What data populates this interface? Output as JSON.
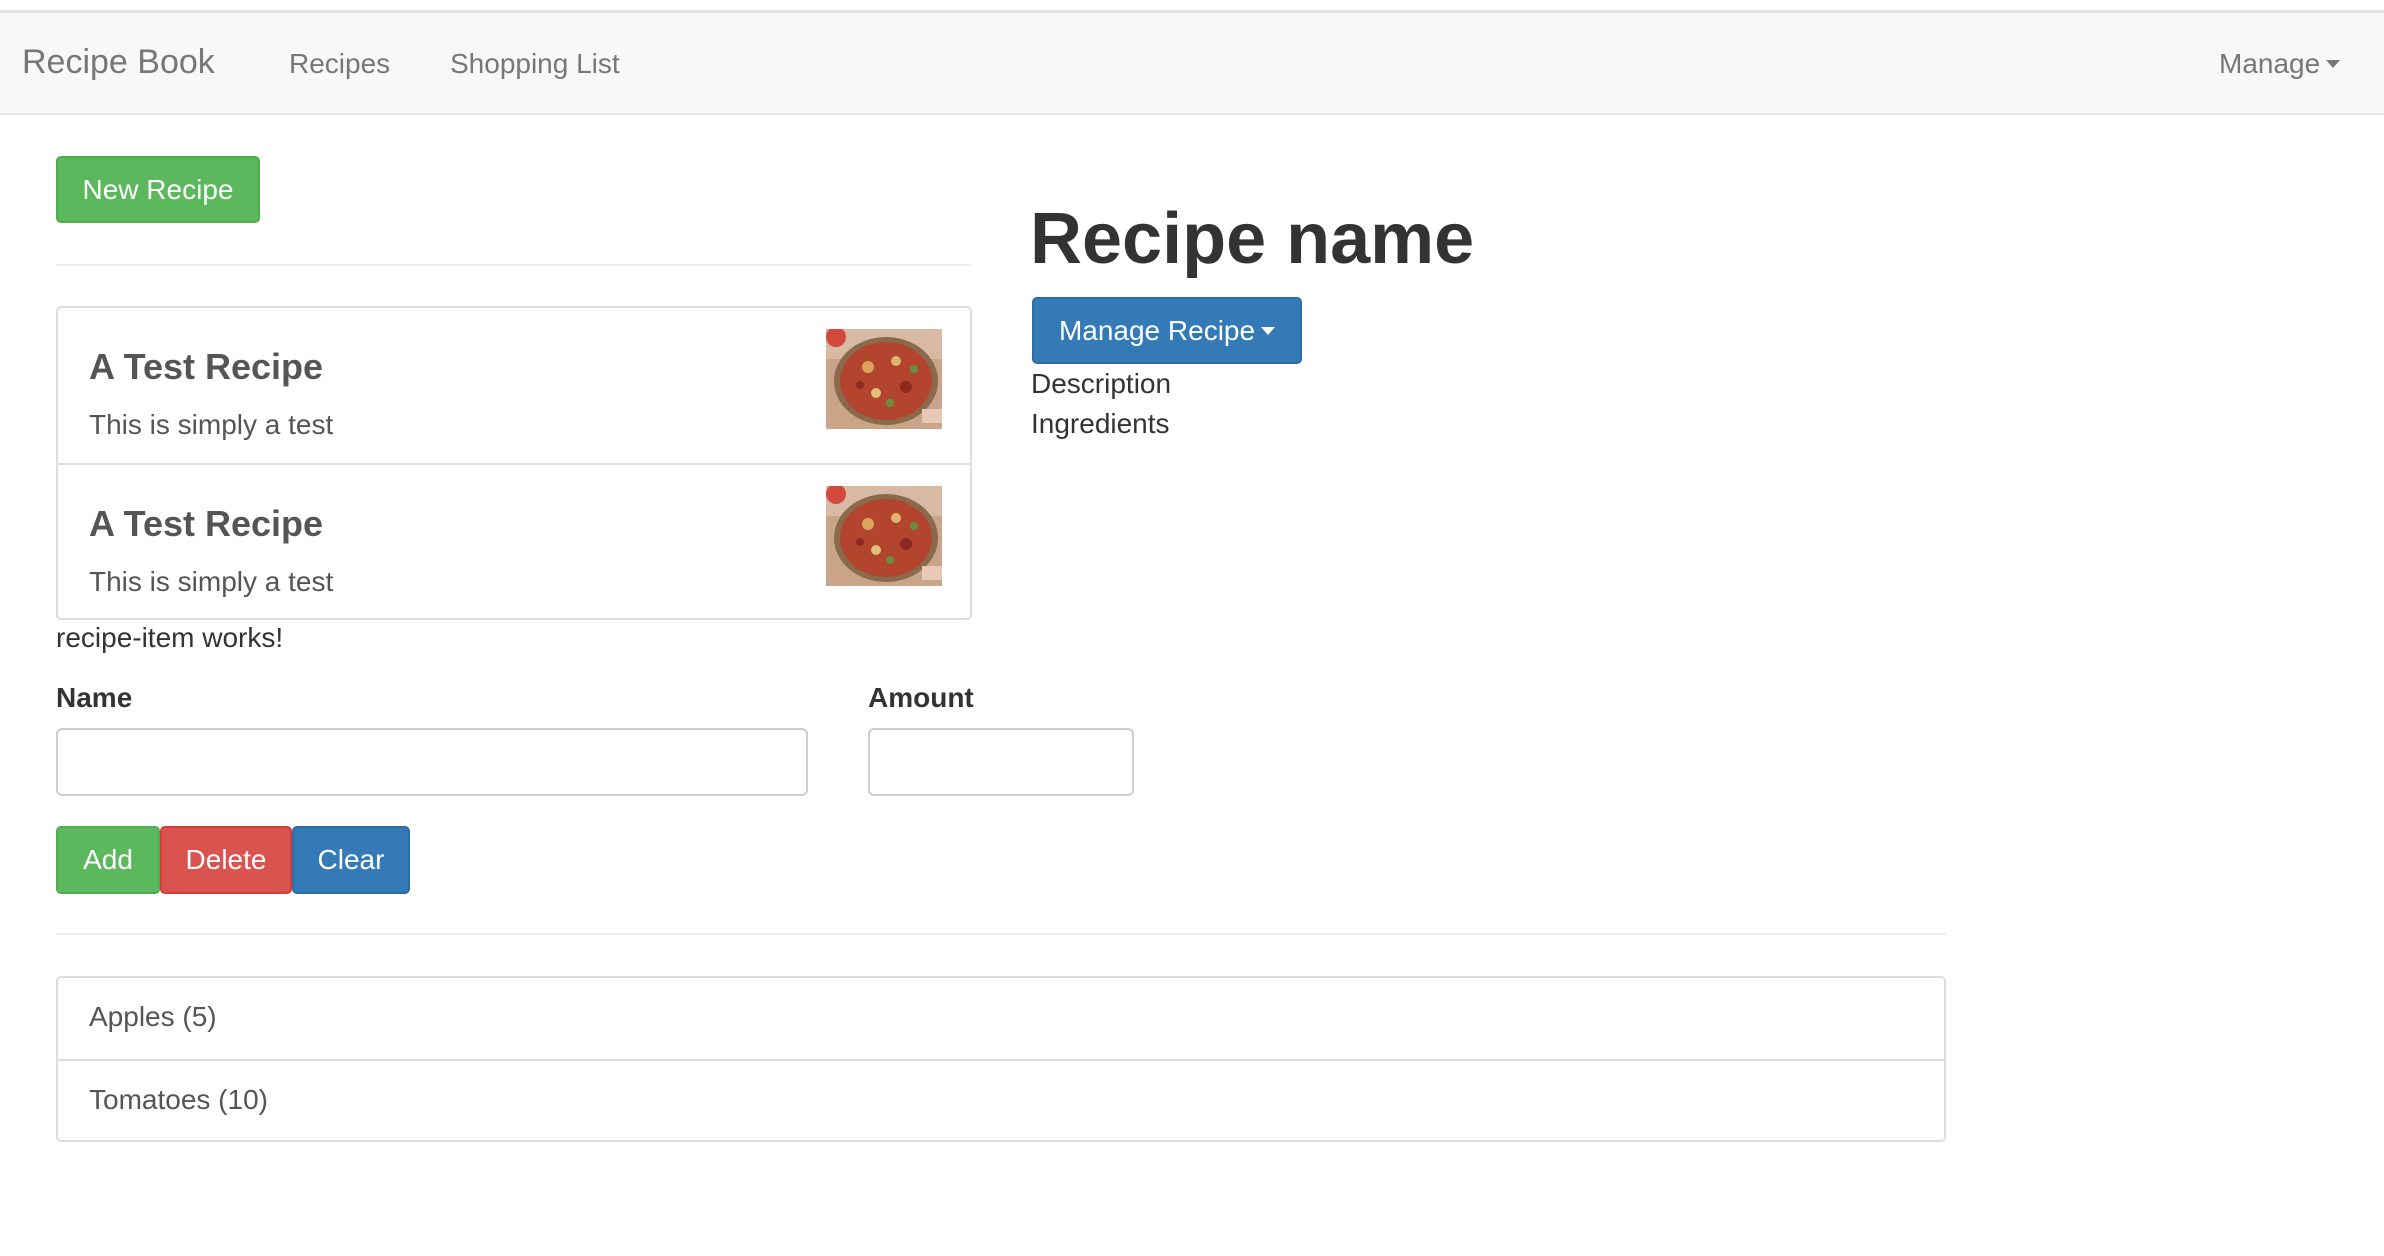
{
  "navbar": {
    "brand": "Recipe Book",
    "links": [
      "Recipes",
      "Shopping List"
    ],
    "manage": "Manage"
  },
  "recipes_panel": {
    "new_recipe_label": "New Recipe",
    "items": [
      {
        "title": "A Test Recipe",
        "description": "This is simply a test"
      },
      {
        "title": "A Test Recipe",
        "description": "This is simply a test"
      }
    ],
    "status_text": "recipe-item works!"
  },
  "recipe_detail": {
    "title": "Recipe name",
    "manage_label": "Manage Recipe",
    "description_label": "Description",
    "ingredients_label": "Ingredients"
  },
  "shopping_edit": {
    "name_label": "Name",
    "amount_label": "Amount",
    "name_value": "",
    "amount_value": "",
    "add_label": "Add",
    "delete_label": "Delete",
    "clear_label": "Clear"
  },
  "shopping_list": {
    "items": [
      "Apples (5)",
      "Tomatoes (10)"
    ]
  },
  "colors": {
    "success": "#5cb85c",
    "danger": "#d9534f",
    "primary": "#337ab7",
    "navbar_bg": "#f8f8f8"
  }
}
